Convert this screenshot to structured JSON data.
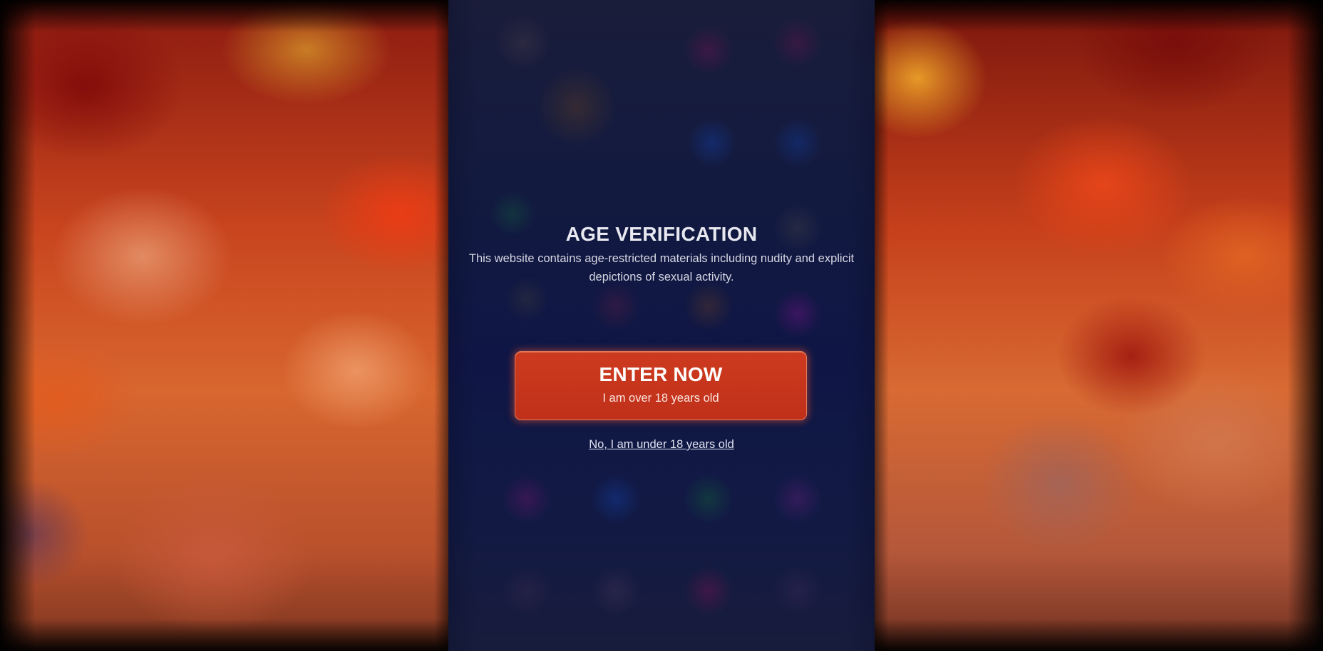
{
  "age_gate": {
    "title": "AGE VERIFICATION",
    "description": "This website contains age-restricted materials including nudity and explicit depictions of sexual activity.",
    "enter_button": {
      "label": "ENTER NOW",
      "sublabel": "I am over 18 years old"
    },
    "exit_link": "No, I am under 18 years old"
  },
  "colors": {
    "enter_button": "#c8341b",
    "panel_background": "#141a3a",
    "side_background": "#c8441e"
  }
}
